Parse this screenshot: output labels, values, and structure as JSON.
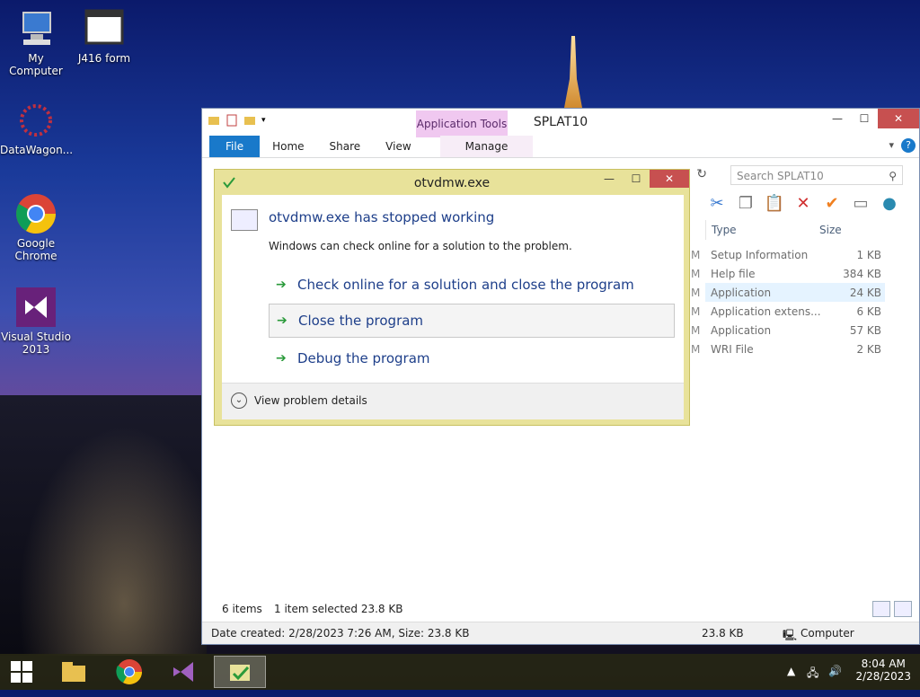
{
  "desktop": {
    "icons": [
      {
        "label": "My Computer",
        "icon": "computer-icon"
      },
      {
        "label": "J416 form",
        "icon": "window-icon"
      },
      {
        "label": "DataWagon...",
        "icon": "datawagon-icon"
      },
      {
        "label": "Google Chrome",
        "icon": "chrome-icon"
      },
      {
        "label": "Visual Studio 2013",
        "icon": "visual-studio-icon"
      }
    ]
  },
  "explorer": {
    "title": "SPLAT10",
    "context_tab_group": "Application Tools",
    "tabs": [
      "File",
      "Home",
      "Share",
      "View",
      "Manage"
    ],
    "search_placeholder": "Search SPLAT10",
    "columns": {
      "type": "Type",
      "size": "Size"
    },
    "files": [
      {
        "type": "Setup Information",
        "size": "1 KB"
      },
      {
        "type": "Help file",
        "size": "384 KB"
      },
      {
        "type": "Application",
        "size": "24 KB",
        "selected": true
      },
      {
        "type": "Application extens...",
        "size": "6 KB"
      },
      {
        "type": "Application",
        "size": "57 KB"
      },
      {
        "type": "WRI File",
        "size": "2 KB"
      }
    ],
    "status": {
      "items_count": "6 items",
      "selected": "1 item selected  23.8 KB",
      "details": "Date created: 2/28/2023 7:26 AM, Size: 23.8 KB",
      "size": "23.8 KB",
      "location": "Computer"
    }
  },
  "dialog": {
    "title": "otvdmw.exe",
    "heading": "otvdmw.exe has stopped working",
    "subtext": "Windows can check online for a solution to the problem.",
    "options": [
      "Check online for a solution and close the program",
      "Close the program",
      "Debug the program"
    ],
    "footer": "View problem details"
  },
  "taskbar": {
    "time": "8:04 AM",
    "date": "2/28/2023"
  },
  "colors": {
    "accent": "#1979ca",
    "dialog_frame": "#e8e29a",
    "close_red": "#c75050",
    "link_blue": "#1e3f8a"
  }
}
